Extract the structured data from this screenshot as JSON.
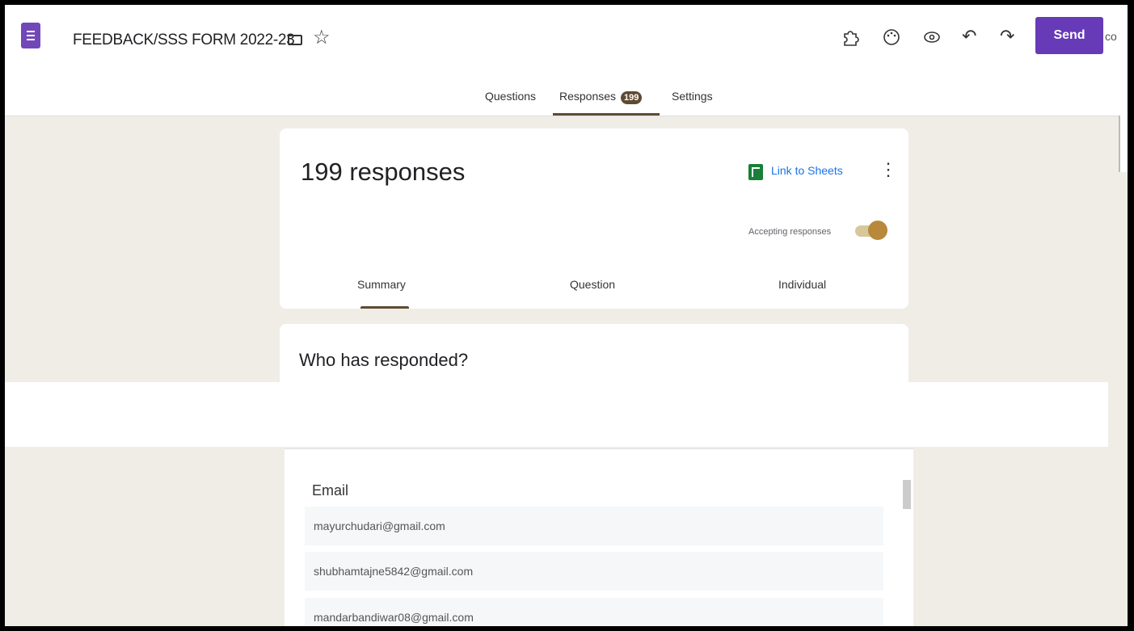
{
  "header": {
    "title": "FEEDBACK/SSS FORM 2022-23",
    "send_label": "Send",
    "overflow_text": "co",
    "icons": [
      "form-logo-icon",
      "folder-icon",
      "star-icon",
      "addon-icon",
      "palette-icon",
      "preview-icon",
      "undo-icon",
      "redo-icon"
    ]
  },
  "tabs": {
    "questions": "Questions",
    "responses": "Responses",
    "responses_count": "199",
    "settings": "Settings"
  },
  "summary": {
    "count_text": "199 responses",
    "link_to_sheets": "Link to Sheets",
    "accepting_label": "Accepting responses",
    "accepting_on": true,
    "subtabs": [
      "Summary",
      "Question",
      "Individual"
    ]
  },
  "who": {
    "title": "Who has responded?",
    "column": "Email",
    "emails": [
      "mayurchudari@gmail.com",
      "shubhamtajne5842@gmail.com",
      "mandarbandiwar08@gmail.com"
    ]
  },
  "colors": {
    "accent": "#673ab7",
    "brown": "#5f4b32",
    "link": "#1a73e8"
  }
}
